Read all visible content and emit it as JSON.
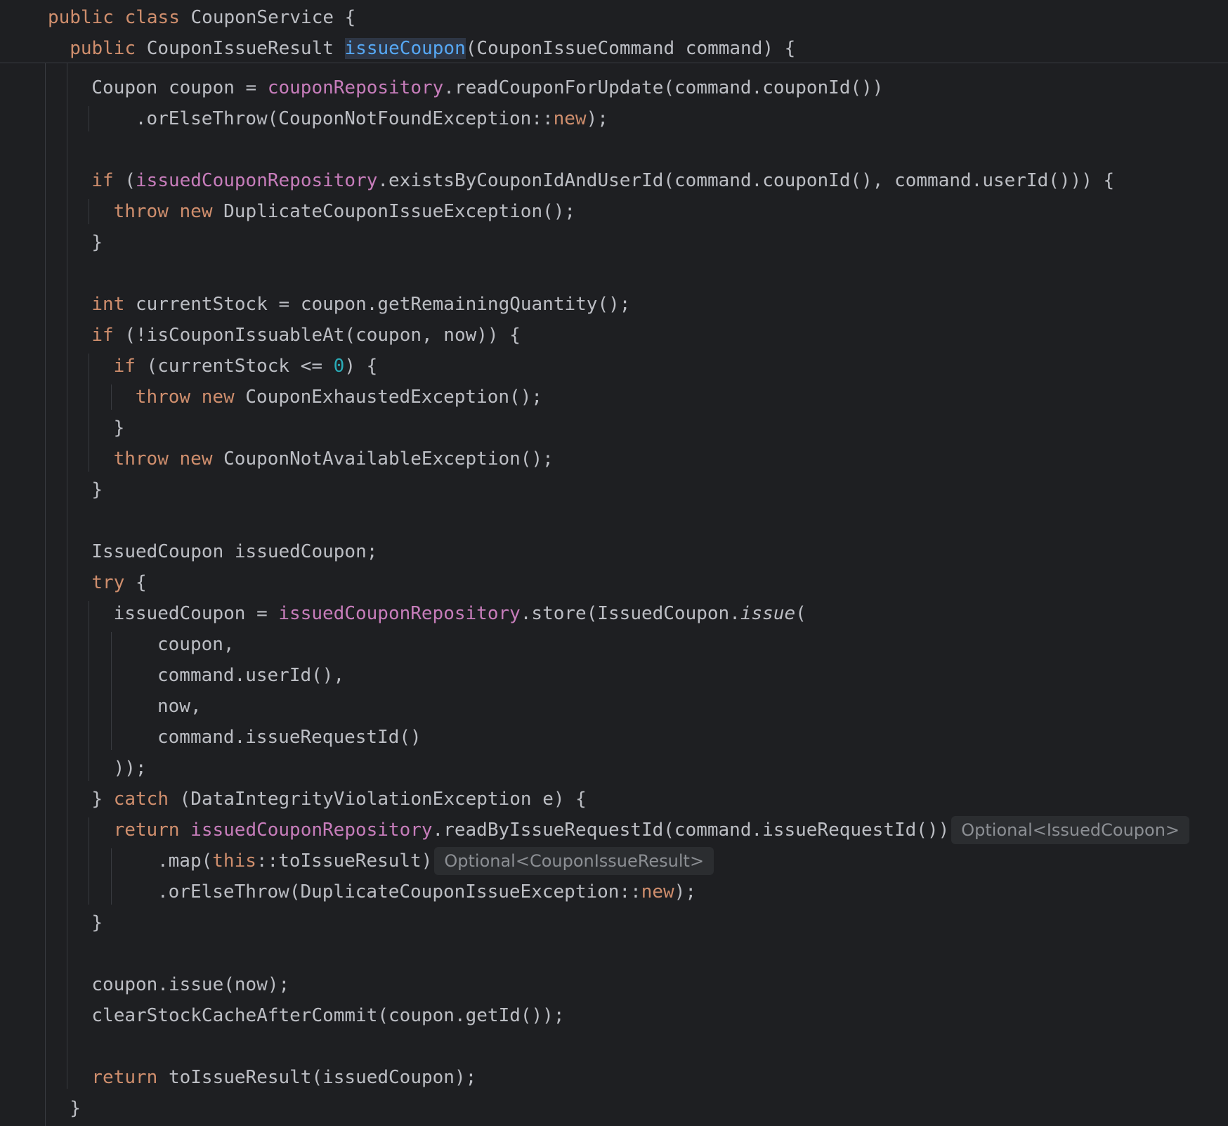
{
  "editor": {
    "sticky_header": [
      {
        "indent": 0,
        "tokens": [
          {
            "t": "public",
            "c": "kw"
          },
          {
            "t": " "
          },
          {
            "t": "class",
            "c": "kw"
          },
          {
            "t": " CouponService {"
          }
        ]
      },
      {
        "indent": 1,
        "tokens": [
          {
            "t": "public",
            "c": "kw"
          },
          {
            "t": " CouponIssueResult "
          },
          {
            "t": "issueCoupon",
            "c": "fn-hl"
          },
          {
            "t": "(CouponIssueCommand command) {"
          }
        ]
      }
    ],
    "code_lines": [
      {
        "indent": 2,
        "tokens": [
          {
            "t": "Coupon coupon = "
          },
          {
            "t": "couponRepository",
            "c": "field"
          },
          {
            "t": ".readCouponForUpdate(command.couponId())"
          }
        ]
      },
      {
        "indent": 4,
        "tokens": [
          {
            "t": ".orElseThrow(CouponNotFoundException::"
          },
          {
            "t": "new",
            "c": "kw"
          },
          {
            "t": ");"
          }
        ]
      },
      {
        "indent": 0,
        "tokens": []
      },
      {
        "indent": 2,
        "tokens": [
          {
            "t": "if",
            "c": "kw"
          },
          {
            "t": " ("
          },
          {
            "t": "issuedCouponRepository",
            "c": "field"
          },
          {
            "t": ".existsByCouponIdAndUserId(command.couponId(), command.userId())) {"
          }
        ]
      },
      {
        "indent": 3,
        "tokens": [
          {
            "t": "throw",
            "c": "kw"
          },
          {
            "t": " "
          },
          {
            "t": "new",
            "c": "kw"
          },
          {
            "t": " DuplicateCouponIssueException();"
          }
        ]
      },
      {
        "indent": 2,
        "tokens": [
          {
            "t": "}"
          }
        ]
      },
      {
        "indent": 0,
        "tokens": []
      },
      {
        "indent": 2,
        "tokens": [
          {
            "t": "int",
            "c": "kw"
          },
          {
            "t": " currentStock = coupon.getRemainingQuantity();"
          }
        ]
      },
      {
        "indent": 2,
        "tokens": [
          {
            "t": "if",
            "c": "kw"
          },
          {
            "t": " (!isCouponIssuableAt(coupon, now)) {"
          }
        ]
      },
      {
        "indent": 3,
        "tokens": [
          {
            "t": "if",
            "c": "kw"
          },
          {
            "t": " (currentStock <= "
          },
          {
            "t": "0",
            "c": "num"
          },
          {
            "t": ") {"
          }
        ]
      },
      {
        "indent": 4,
        "tokens": [
          {
            "t": "throw",
            "c": "kw"
          },
          {
            "t": " "
          },
          {
            "t": "new",
            "c": "kw"
          },
          {
            "t": " CouponExhaustedException();"
          }
        ]
      },
      {
        "indent": 3,
        "tokens": [
          {
            "t": "}"
          }
        ]
      },
      {
        "indent": 3,
        "tokens": [
          {
            "t": "throw",
            "c": "kw"
          },
          {
            "t": " "
          },
          {
            "t": "new",
            "c": "kw"
          },
          {
            "t": " CouponNotAvailableException();"
          }
        ]
      },
      {
        "indent": 2,
        "tokens": [
          {
            "t": "}"
          }
        ]
      },
      {
        "indent": 0,
        "tokens": []
      },
      {
        "indent": 2,
        "tokens": [
          {
            "t": "IssuedCoupon issuedCoupon;"
          }
        ]
      },
      {
        "indent": 2,
        "tokens": [
          {
            "t": "try",
            "c": "kw"
          },
          {
            "t": " {"
          }
        ]
      },
      {
        "indent": 3,
        "tokens": [
          {
            "t": "issuedCoupon = "
          },
          {
            "t": "issuedCouponRepository",
            "c": "field"
          },
          {
            "t": ".store(IssuedCoupon."
          },
          {
            "t": "issue",
            "c": "italic"
          },
          {
            "t": "("
          }
        ]
      },
      {
        "indent": 5,
        "tokens": [
          {
            "t": "coupon,"
          }
        ]
      },
      {
        "indent": 5,
        "tokens": [
          {
            "t": "command.userId(),"
          }
        ]
      },
      {
        "indent": 5,
        "tokens": [
          {
            "t": "now,"
          }
        ]
      },
      {
        "indent": 5,
        "tokens": [
          {
            "t": "command.issueRequestId()"
          }
        ]
      },
      {
        "indent": 3,
        "tokens": [
          {
            "t": "));"
          }
        ]
      },
      {
        "indent": 2,
        "tokens": [
          {
            "t": "} "
          },
          {
            "t": "catch",
            "c": "kw"
          },
          {
            "t": " (DataIntegrityViolationException e) {"
          }
        ]
      },
      {
        "indent": 3,
        "tokens": [
          {
            "t": "return",
            "c": "kw"
          },
          {
            "t": " "
          },
          {
            "t": "issuedCouponRepository",
            "c": "field"
          },
          {
            "t": ".readByIssueRequestId(command.issueRequestId())"
          }
        ],
        "hint": "Optional<IssuedCoupon>"
      },
      {
        "indent": 5,
        "tokens": [
          {
            "t": ".map("
          },
          {
            "t": "this",
            "c": "kw"
          },
          {
            "t": "::toIssueResult)"
          }
        ],
        "hint": "Optional<CouponIssueResult>"
      },
      {
        "indent": 5,
        "tokens": [
          {
            "t": ".orElseThrow(DuplicateCouponIssueException::"
          },
          {
            "t": "new",
            "c": "kw"
          },
          {
            "t": ");"
          }
        ]
      },
      {
        "indent": 2,
        "tokens": [
          {
            "t": "}"
          }
        ]
      },
      {
        "indent": 0,
        "tokens": []
      },
      {
        "indent": 2,
        "tokens": [
          {
            "t": "coupon.issue(now);"
          }
        ]
      },
      {
        "indent": 2,
        "tokens": [
          {
            "t": "clearStockCacheAfterCommit(coupon.getId());"
          }
        ]
      },
      {
        "indent": 0,
        "tokens": []
      },
      {
        "indent": 2,
        "tokens": [
          {
            "t": "return",
            "c": "kw"
          },
          {
            "t": " toIssueResult(issuedCoupon);"
          }
        ]
      },
      {
        "indent": 1,
        "tokens": [
          {
            "t": "}"
          }
        ]
      }
    ],
    "colors": {
      "background": "#1e1f22",
      "text": "#bcbec4",
      "keyword": "#cf8e6d",
      "field": "#c77dbb",
      "number": "#2aacb8",
      "method_highlight": "#56a8f5",
      "inlay_hint_text": "#8c8f94",
      "inlay_hint_bg": "#2b2d30"
    }
  }
}
